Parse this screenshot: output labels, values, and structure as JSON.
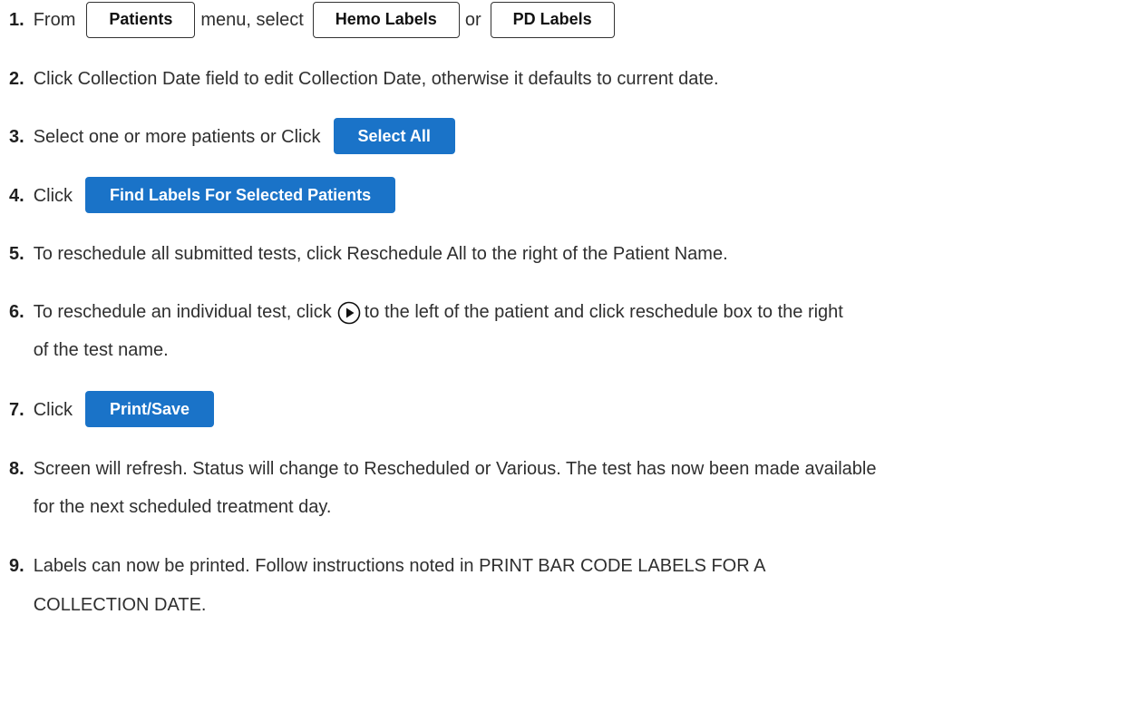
{
  "steps": [
    {
      "num": "1.",
      "parts": [
        "From",
        "menu, select",
        "or"
      ],
      "buttons": [
        "Patients",
        "Hemo Labels",
        "PD Labels"
      ]
    },
    {
      "num": "2.",
      "text": "Click Collection Date field to edit Collection Date, otherwise it defaults to current date."
    },
    {
      "num": "3.",
      "text": "Select one or more patients or Click",
      "button": "Select All"
    },
    {
      "num": "4.",
      "text": "Click",
      "button": "Find Labels For Selected Patients"
    },
    {
      "num": "5.",
      "text": "To reschedule all submitted tests, click Reschedule All to the right of the Patient Name."
    },
    {
      "num": "6.",
      "text_before": "To reschedule an individual test, click",
      "text_after": "to the left of the patient and click reschedule box to the right",
      "text_cont": "of the test name.",
      "icon": "play-circle-icon"
    },
    {
      "num": "7.",
      "text": "Click",
      "button": "Print/Save"
    },
    {
      "num": "8.",
      "text": "Screen will refresh.  Status will change to Rescheduled or Various. The test has now been made available",
      "text_cont": "for the next scheduled treatment day."
    },
    {
      "num": "9.",
      "text": "Labels can now be printed.  Follow instructions noted in PRINT BAR CODE LABELS FOR A",
      "text_cont": "COLLECTION DATE."
    }
  ],
  "colors": {
    "accent_blue": "#1a73c8",
    "text": "#2f2f2f"
  }
}
